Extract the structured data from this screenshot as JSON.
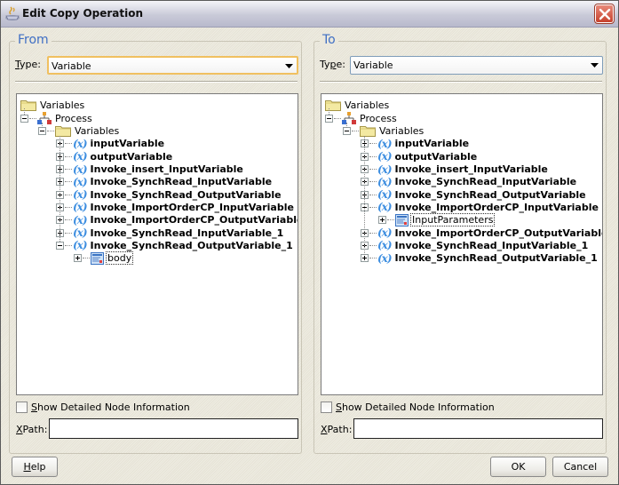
{
  "window": {
    "title": "Edit Copy Operation",
    "icon": "coffee-cup-icon"
  },
  "from": {
    "title": "From",
    "type_label": "Type:",
    "type_mnemonic": "T",
    "type_rest": "ype:",
    "type_value": "Variable",
    "tree": [
      {
        "label": "Variables",
        "icon": "folder-icon",
        "level": 0,
        "expander": null,
        "bold": false
      },
      {
        "label": "Process",
        "icon": "process-icon",
        "level": 1,
        "expander": "minus",
        "bold": false
      },
      {
        "label": "Variables",
        "icon": "folder-icon",
        "level": 2,
        "expander": "minus",
        "bold": false
      },
      {
        "label": "inputVariable",
        "icon": "variable-icon",
        "level": 3,
        "expander": "plus",
        "bold": true
      },
      {
        "label": "outputVariable",
        "icon": "variable-icon",
        "level": 3,
        "expander": "plus",
        "bold": true
      },
      {
        "label": "Invoke_insert_InputVariable",
        "icon": "variable-icon",
        "level": 3,
        "expander": "plus",
        "bold": true
      },
      {
        "label": "Invoke_SynchRead_InputVariable",
        "icon": "variable-icon",
        "level": 3,
        "expander": "plus",
        "bold": true
      },
      {
        "label": "Invoke_SynchRead_OutputVariable",
        "icon": "variable-icon",
        "level": 3,
        "expander": "plus",
        "bold": true
      },
      {
        "label": "Invoke_ImportOrderCP_InputVariable",
        "icon": "variable-icon",
        "level": 3,
        "expander": "plus",
        "bold": true
      },
      {
        "label": "Invoke_ImportOrderCP_OutputVariable",
        "icon": "variable-icon",
        "level": 3,
        "expander": "plus",
        "bold": true
      },
      {
        "label": "Invoke_SynchRead_InputVariable_1",
        "icon": "variable-icon",
        "level": 3,
        "expander": "plus",
        "bold": true
      },
      {
        "label": "Invoke_SynchRead_OutputVariable_1",
        "icon": "variable-icon",
        "level": 3,
        "expander": "minus",
        "bold": true
      },
      {
        "label": "body",
        "icon": "message-part-icon",
        "level": 4,
        "expander": "plus",
        "bold": false,
        "selected": true
      }
    ],
    "show_detail_label": "Show Detailed Node Information",
    "show_detail_mnemonic": "S",
    "show_detail_rest": "how Detailed Node Information",
    "show_detail_checked": false,
    "xpath_label": "XPath:",
    "xpath_mnemonic": "X",
    "xpath_rest": "Path:",
    "xpath_value": ""
  },
  "to": {
    "title": "To",
    "type_label": "Type:",
    "type_pre": "Ty",
    "type_mnemonic": "p",
    "type_rest": "e:",
    "type_value": "Variable",
    "tree": [
      {
        "label": "Variables",
        "icon": "folder-icon",
        "level": 0,
        "expander": null,
        "bold": false
      },
      {
        "label": "Process",
        "icon": "process-icon",
        "level": 1,
        "expander": "minus",
        "bold": false
      },
      {
        "label": "Variables",
        "icon": "folder-icon",
        "level": 2,
        "expander": "minus",
        "bold": false
      },
      {
        "label": "inputVariable",
        "icon": "variable-icon",
        "level": 3,
        "expander": "plus",
        "bold": true
      },
      {
        "label": "outputVariable",
        "icon": "variable-icon",
        "level": 3,
        "expander": "plus",
        "bold": true
      },
      {
        "label": "Invoke_insert_InputVariable",
        "icon": "variable-icon",
        "level": 3,
        "expander": "plus",
        "bold": true
      },
      {
        "label": "Invoke_SynchRead_InputVariable",
        "icon": "variable-icon",
        "level": 3,
        "expander": "plus",
        "bold": true
      },
      {
        "label": "Invoke_SynchRead_OutputVariable",
        "icon": "variable-icon",
        "level": 3,
        "expander": "plus",
        "bold": true
      },
      {
        "label": "Invoke_ImportOrderCP_InputVariable",
        "icon": "variable-icon",
        "level": 3,
        "expander": "minus",
        "bold": true
      },
      {
        "label": "InputParameters",
        "icon": "message-part-icon",
        "level": 4,
        "expander": "plus",
        "bold": false,
        "selected": true
      },
      {
        "label": "Invoke_ImportOrderCP_OutputVariable",
        "icon": "variable-icon",
        "level": 3,
        "expander": "plus",
        "bold": true
      },
      {
        "label": "Invoke_SynchRead_InputVariable_1",
        "icon": "variable-icon",
        "level": 3,
        "expander": "plus",
        "bold": true
      },
      {
        "label": "Invoke_SynchRead_OutputVariable_1",
        "icon": "variable-icon",
        "level": 3,
        "expander": "plus",
        "bold": true
      }
    ],
    "show_detail_label": "Show Detailed Node Information",
    "show_detail_mnemonic": "S",
    "show_detail_rest": "how Detailed Node Information",
    "show_detail_checked": false,
    "xpath_label": "XPath:",
    "xpath_mnemonic": "X",
    "xpath_rest": "Path:",
    "xpath_value": ""
  },
  "buttons": {
    "help": "Help",
    "help_mnemonic": "H",
    "help_rest": "elp",
    "ok": "OK",
    "cancel": "Cancel"
  },
  "colors": {
    "group_title": "#3f6fc4",
    "variable_icon": "#3d8ee0",
    "focus_border": "#f0c060"
  }
}
